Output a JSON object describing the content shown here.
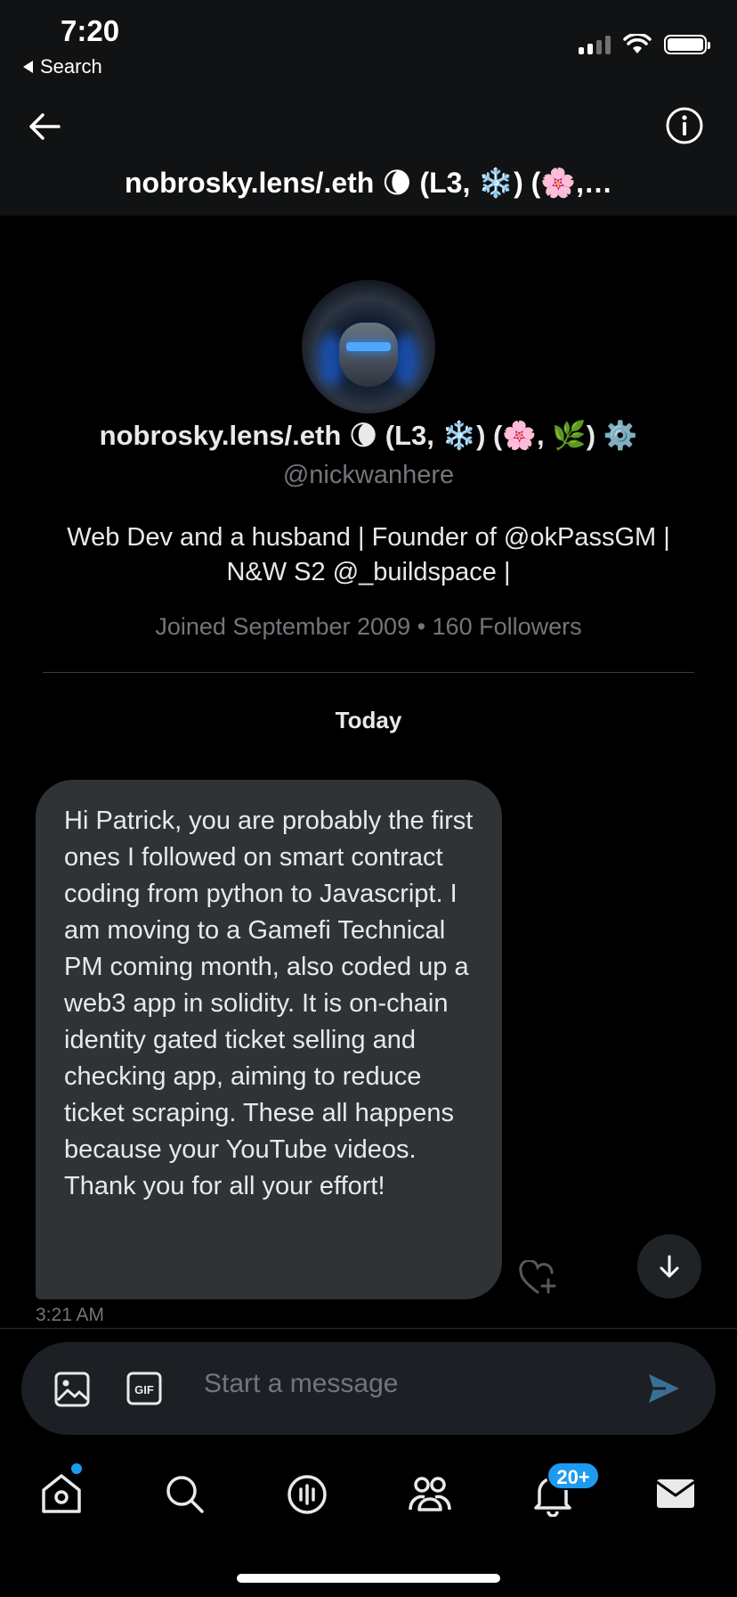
{
  "status_bar": {
    "time": "7:20",
    "back_label": "Search"
  },
  "header": {
    "title": "nobrosky.lens/.eth 🌘 (L3, ❄️) (🌸,…"
  },
  "profile": {
    "name": "nobrosky.lens/.eth 🌘 (L3, ❄️) (🌸, 🌿) ⚙️",
    "handle": "@nickwanhere",
    "bio_line1": "Web Dev and a husband | Founder of @okPassGM |",
    "bio_line2": "N&W S2 @_buildspace |",
    "meta": "Joined September 2009 • 160 Followers"
  },
  "conversation": {
    "date_label": "Today",
    "messages": [
      {
        "text": "Hi Patrick, you are probably the first ones I followed on smart contract coding from python to Javascript. I am moving to a Gamefi Technical PM coming month, also coded up a web3 app in solidity. It is on-chain identity gated ticket selling and checking app, aiming to reduce ticket scraping. These all happens because your YouTube videos. Thank you for all your effort!",
        "time": "3:21 AM"
      }
    ]
  },
  "composer": {
    "placeholder": "Start a message"
  },
  "tabbar": {
    "notifications_badge": "20+"
  },
  "colors": {
    "accent": "#1d9bf0",
    "bubble": "#2f3336",
    "muted": "#71767b"
  }
}
